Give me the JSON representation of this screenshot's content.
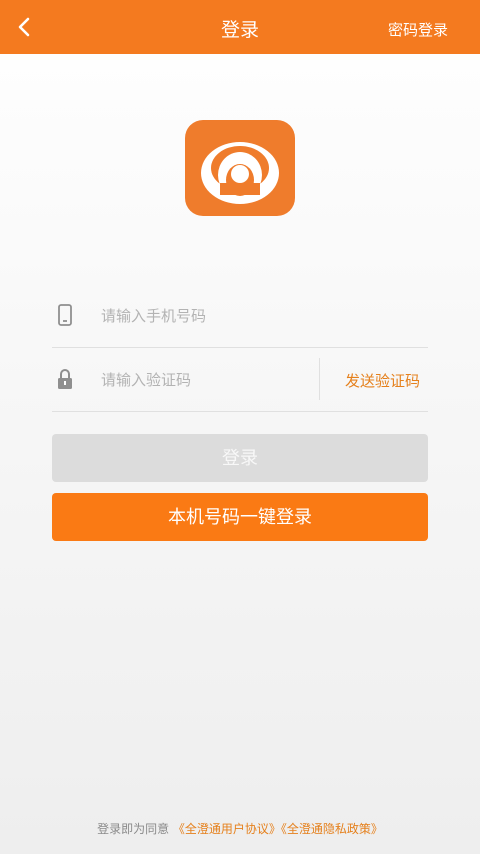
{
  "colors": {
    "brand": "#f47a1f",
    "link": "#e5801c",
    "disabled_button": "#dcdcdc"
  },
  "header": {
    "back_icon": "chevron-left-icon",
    "title": "登录",
    "password_login": "密码登录"
  },
  "logo": {
    "icon": "app-logo-icon"
  },
  "form": {
    "phone": {
      "icon": "phone-icon",
      "placeholder": "请输入手机号码",
      "value": ""
    },
    "code": {
      "icon": "lock-icon",
      "placeholder": "请输入验证码",
      "value": "",
      "send_code_label": "发送验证码"
    }
  },
  "buttons": {
    "login": "登录",
    "one_key_login": "本机号码一键登录"
  },
  "agreement": {
    "prefix": "登录即为同意",
    "user_agreement": "《全澄通用户协议》",
    "privacy_policy": "《全澄通隐私政策》"
  }
}
